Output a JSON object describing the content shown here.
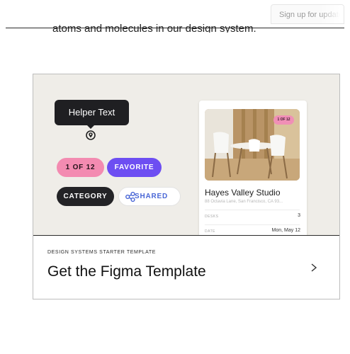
{
  "header": {
    "signup_label": "Sign up for updates",
    "intro_tail": "atoms and molecules in our design system."
  },
  "preview": {
    "tooltip_text": "Helper Text",
    "chips": {
      "count": "1 OF 12",
      "favorite": "FAVORITE",
      "category": "CATEGORY",
      "shared": "SHARED"
    },
    "listing": {
      "badge": "1 OF 12",
      "title": "Hayes Valley Studio",
      "address": "88 Octavia Lane, San Francisco, CA 93...",
      "details": [
        {
          "label": "DESKS",
          "value": "3"
        },
        {
          "label": "DATE",
          "value": "Mon, May 12"
        }
      ]
    }
  },
  "template": {
    "kicker": "DESIGN SYSTEMS STARTER TEMPLATE",
    "title": "Get the Figma Template"
  },
  "icons": {
    "pin": "map-pin-icon",
    "share": "share-nodes-icon",
    "chevron": "chevron-right-icon"
  },
  "colors": {
    "preview_background": "#efede8",
    "pink_chip": "#f38bb1",
    "purple_chip": "#6d4ef2",
    "dark_chip": "#232326",
    "shared_text": "#4a67d6"
  }
}
